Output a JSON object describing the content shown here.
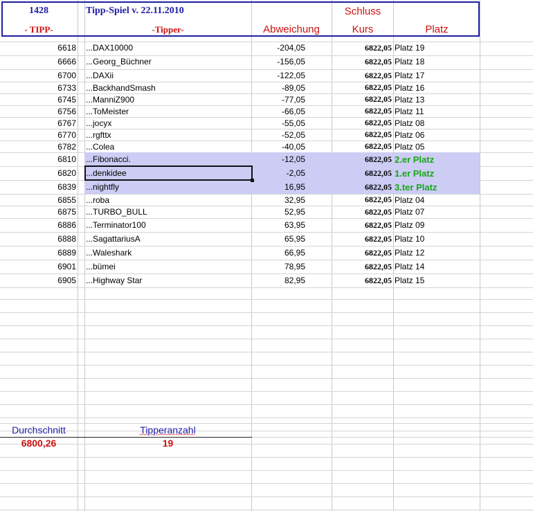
{
  "header": {
    "row1": {
      "tipp_count": "1428",
      "title": "Tipp-Spiel v. 22.11.2010",
      "schluss": "Schluss"
    },
    "row2": {
      "tipp": "- TIPP-",
      "tipper": "-Tipper-",
      "abweichung": "Abweichung",
      "kurs": "Kurs",
      "platz": "Platz"
    }
  },
  "rows": [
    {
      "tipp": "6618",
      "name": "...DAX10000",
      "abw": "-204,05",
      "kurs": "6822,05",
      "platz": "Platz 19"
    },
    {
      "tipp": "6666",
      "name": "...Georg_Büchner",
      "abw": "-156,05",
      "kurs": "6822,05",
      "platz": "Platz 18"
    },
    {
      "tipp": "6700",
      "name": "...DAXii",
      "abw": "-122,05",
      "kurs": "6822,05",
      "platz": "Platz 17"
    },
    {
      "tipp": "6733",
      "name": "...BackhandSmash",
      "abw": "-89,05",
      "kurs": "6822,05",
      "platz": "Platz 16"
    },
    {
      "tipp": "6745",
      "name": "...ManniZ900",
      "abw": "-77,05",
      "kurs": "6822,05",
      "platz": "Platz 13"
    },
    {
      "tipp": "6756",
      "name": "...ToMeister",
      "abw": "-66,05",
      "kurs": "6822,05",
      "platz": "Platz 11"
    },
    {
      "tipp": "6767",
      "name": "...jocyx",
      "abw": "-55,05",
      "kurs": "6822,05",
      "platz": "Platz 08"
    },
    {
      "tipp": "6770",
      "name": "...rgfttx",
      "abw": "-52,05",
      "kurs": "6822,05",
      "platz": "Platz 06"
    },
    {
      "tipp": "6782",
      "name": "...Colea",
      "abw": "-40,05",
      "kurs": "6822,05",
      "platz": "Platz 05"
    },
    {
      "tipp": "6810",
      "name": "...Fibonacci.",
      "abw": "-12,05",
      "kurs": "6822,05",
      "platz": "2.er Platz"
    },
    {
      "tipp": "6820",
      "name": "...denkidee",
      "abw": "-2,05",
      "kurs": "6822,05",
      "platz": "1.er Platz"
    },
    {
      "tipp": "6839",
      "name": "...nightfly",
      "abw": "16,95",
      "kurs": "6822,05",
      "platz": "3.ter Platz"
    },
    {
      "tipp": "6855",
      "name": "...roba",
      "abw": "32,95",
      "kurs": "6822,05",
      "platz": "Platz 04"
    },
    {
      "tipp": "6875",
      "name": "...TURBO_BULL",
      "abw": "52,95",
      "kurs": "6822,05",
      "platz": "Platz 07"
    },
    {
      "tipp": "6886",
      "name": "...Terminator100",
      "abw": "63,95",
      "kurs": "6822,05",
      "platz": "Platz 09"
    },
    {
      "tipp": "6888",
      "name": "...SagattariusA",
      "abw": "65,95",
      "kurs": "6822,05",
      "platz": "Platz 10"
    },
    {
      "tipp": "6889",
      "name": "...Waleshark",
      "abw": "66,95",
      "kurs": "6822,05",
      "platz": "Platz 12"
    },
    {
      "tipp": "6901",
      "name": "...bümei",
      "abw": "78,95",
      "kurs": "6822,05",
      "platz": "Platz 14"
    },
    {
      "tipp": "6905",
      "name": "...Highway Star",
      "abw": "82,95",
      "kurs": "6822,05",
      "platz": "Platz 15"
    }
  ],
  "footer": {
    "durchschnitt_label": "Durchschnitt",
    "durchschnitt_value": "6800,26",
    "tipperanzahl_label": "Tipperanzahl",
    "tipperanzahl_value": "19"
  },
  "colors": {
    "header_blue": "#1c1ca8",
    "header_red": "#cc1111",
    "highlight": "#ccccf4",
    "winner_green": "#18a618"
  }
}
